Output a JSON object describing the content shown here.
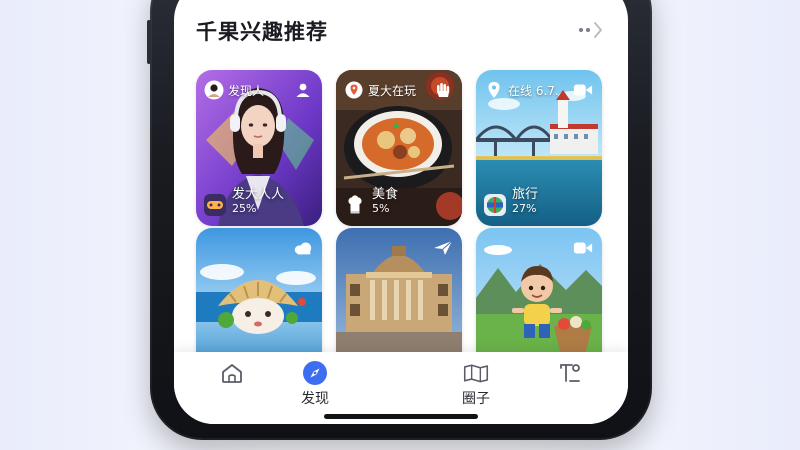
{
  "section": {
    "title": "千果兴趣推荐",
    "more_icon": "more-dots-chevron-icon"
  },
  "cards": [
    {
      "tag": "发现人",
      "tag_icon": "avatar-icon",
      "corner_icon": "user-icon",
      "name": "发大人人",
      "percent": "25%",
      "caption_icon": "controller-icon",
      "scene": "woman-with-headphones"
    },
    {
      "tag": "夏大在玩",
      "tag_icon": "location-pin-icon",
      "corner_icon": "hand-icon",
      "name": "美食",
      "percent": "5%",
      "caption_icon": "chef-icon",
      "scene": "bowl-of-food"
    },
    {
      "tag": "在线 6.7.",
      "tag_icon": "location-pin-icon",
      "corner_icon": "video-icon",
      "name": "旅行",
      "percent": "27%",
      "caption_icon": "globe-icon",
      "scene": "bridge-and-lighthouse"
    },
    {
      "tag": "",
      "tag_icon": "",
      "corner_icon": "cloud-icon",
      "name": "",
      "percent": "",
      "caption_icon": "",
      "scene": "mushroom-character"
    },
    {
      "tag": "",
      "tag_icon": "",
      "corner_icon": "plane-icon",
      "name": "",
      "percent": "",
      "caption_icon": "",
      "scene": "classical-building"
    },
    {
      "tag": "",
      "tag_icon": "",
      "corner_icon": "video-icon",
      "name": "",
      "percent": "",
      "caption_icon": "",
      "scene": "boy-with-basket"
    }
  ],
  "tabbar": {
    "tabs": [
      {
        "label": "",
        "icon": "home-icon",
        "active": false
      },
      {
        "label": "发现",
        "icon": "compass-icon",
        "active": true
      },
      {
        "label": "圈子",
        "icon": "map-icon",
        "active": false
      },
      {
        "label": "",
        "icon": "profile-icon",
        "active": false
      }
    ]
  },
  "colors": {
    "accent": "#3d6df0",
    "text": "#1b1c22",
    "icon": "#5a5d68"
  }
}
